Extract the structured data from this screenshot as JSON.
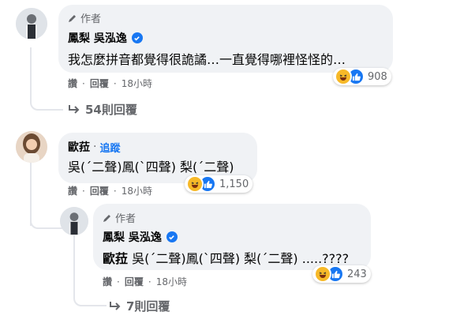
{
  "comments": [
    {
      "author_badge": "作者",
      "author": "鳳梨 吳泓逸",
      "verified": true,
      "text": "我怎麼拼音都覺得很詭譎…一直覺得哪裡怪怪的…",
      "actions": {
        "like": "讚",
        "reply": "回覆",
        "time": "18小時"
      },
      "reactions": {
        "icons": [
          "haha-icon",
          "like-icon"
        ],
        "count": "908"
      },
      "view_replies": "54則回覆"
    },
    {
      "author": "歐菈",
      "follow": "追蹤",
      "text": "吳(ˊ二聲)鳳(ˋ四聲) 梨(ˊ二聲)",
      "actions": {
        "like": "讚",
        "reply": "回覆",
        "time": "18小時"
      },
      "reactions": {
        "icons": [
          "haha-icon",
          "like-icon"
        ],
        "count": "1,150"
      }
    },
    {
      "author_badge": "作者",
      "author": "鳳梨 吳泓逸",
      "verified": true,
      "mention": "歐菈",
      "text": "吳(ˊ二聲)鳳(ˋ四聲) 梨(ˊ二聲) .....????",
      "actions": {
        "like": "讚",
        "reply": "回覆",
        "time": "18小時"
      },
      "reactions": {
        "icons": [
          "haha-icon",
          "like-icon"
        ],
        "count": "243"
      },
      "view_replies": "7則回覆"
    }
  ],
  "colors": {
    "bubble": "#f0f2f5",
    "secondary_text": "#65676b",
    "accent": "#1877f2",
    "haha": "#f7b928"
  }
}
